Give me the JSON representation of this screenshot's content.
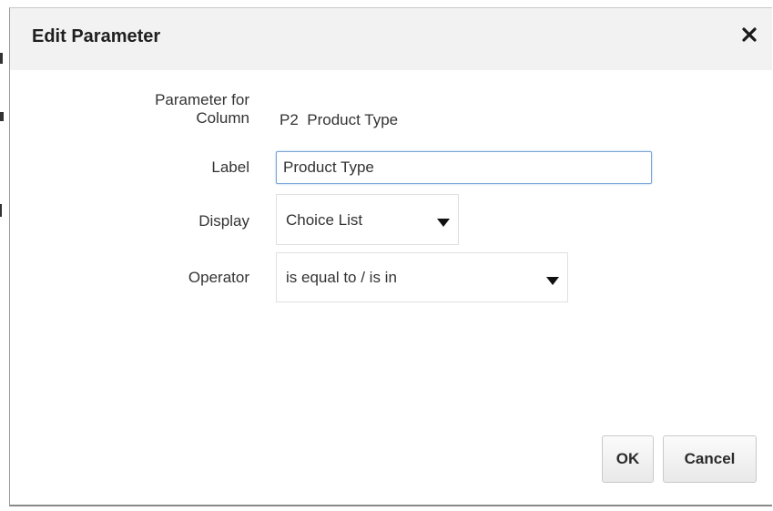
{
  "dialog": {
    "title": "Edit Parameter",
    "close_icon": "close-icon"
  },
  "form": {
    "parameter_for_column": {
      "label_line1": "Parameter for",
      "label_line2": "Column",
      "value": "P2  Product Type"
    },
    "label": {
      "label": "Label",
      "value": "Product Type"
    },
    "display": {
      "label": "Display",
      "selected": "Choice List",
      "caret_icon": "caret-down-icon"
    },
    "operator": {
      "label": "Operator",
      "selected": "is equal to / is in",
      "caret_icon": "caret-down-icon"
    }
  },
  "buttons": {
    "ok": "OK",
    "cancel": "Cancel"
  }
}
